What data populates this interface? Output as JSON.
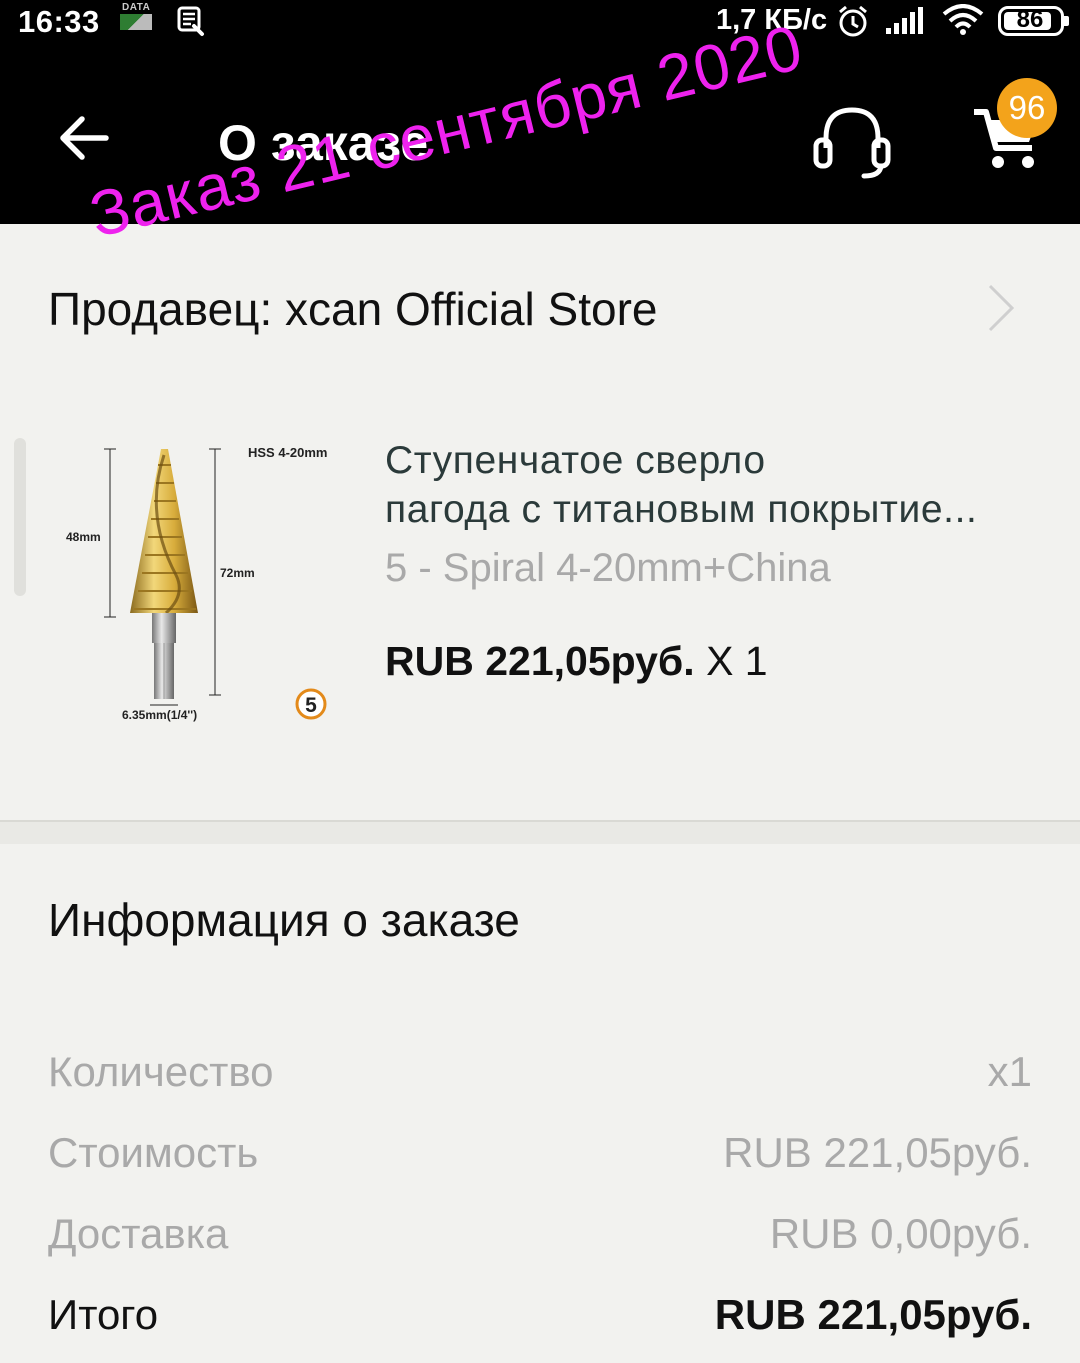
{
  "status_bar": {
    "time": "16:33",
    "data_label": "DATA",
    "network_speed": "1,7 КБ/с",
    "battery": "86"
  },
  "header": {
    "title": "О заказе",
    "cart_count": "96",
    "icons": [
      "back-arrow-icon",
      "support-headset-icon",
      "cart-icon"
    ]
  },
  "watermark": "Заказ 21 сентября 2020",
  "seller": {
    "label": "Продавец: xcan Official Store"
  },
  "product": {
    "title_line1": "Ступенчатое сверло",
    "title_line2": "пагода с титановым покрытие...",
    "variant": "5 - Spiral 4-20mm+China",
    "price": "RUB 221,05руб.",
    "quantity": "X 1",
    "image_labels": {
      "spec": "HSS 4-20mm",
      "length_short": "48mm",
      "length_total": "72mm",
      "shank": "6.35mm(1/4'')",
      "badge": "5"
    }
  },
  "order_info": {
    "title": "Информация о заказе",
    "rows": [
      {
        "label": "Количество",
        "value": "x1"
      },
      {
        "label": "Стоимость",
        "value": "RUB 221,05руб."
      },
      {
        "label": "Доставка",
        "value": "RUB 0,00руб."
      },
      {
        "label": "Итого",
        "value": "RUB 221,05руб."
      }
    ]
  },
  "colors": {
    "bar_background": "#000000",
    "page_background": "#f2f2ef",
    "badge": "#f3a31b",
    "watermark": "#ee22ee",
    "muted_text": "#a9a9a9"
  }
}
